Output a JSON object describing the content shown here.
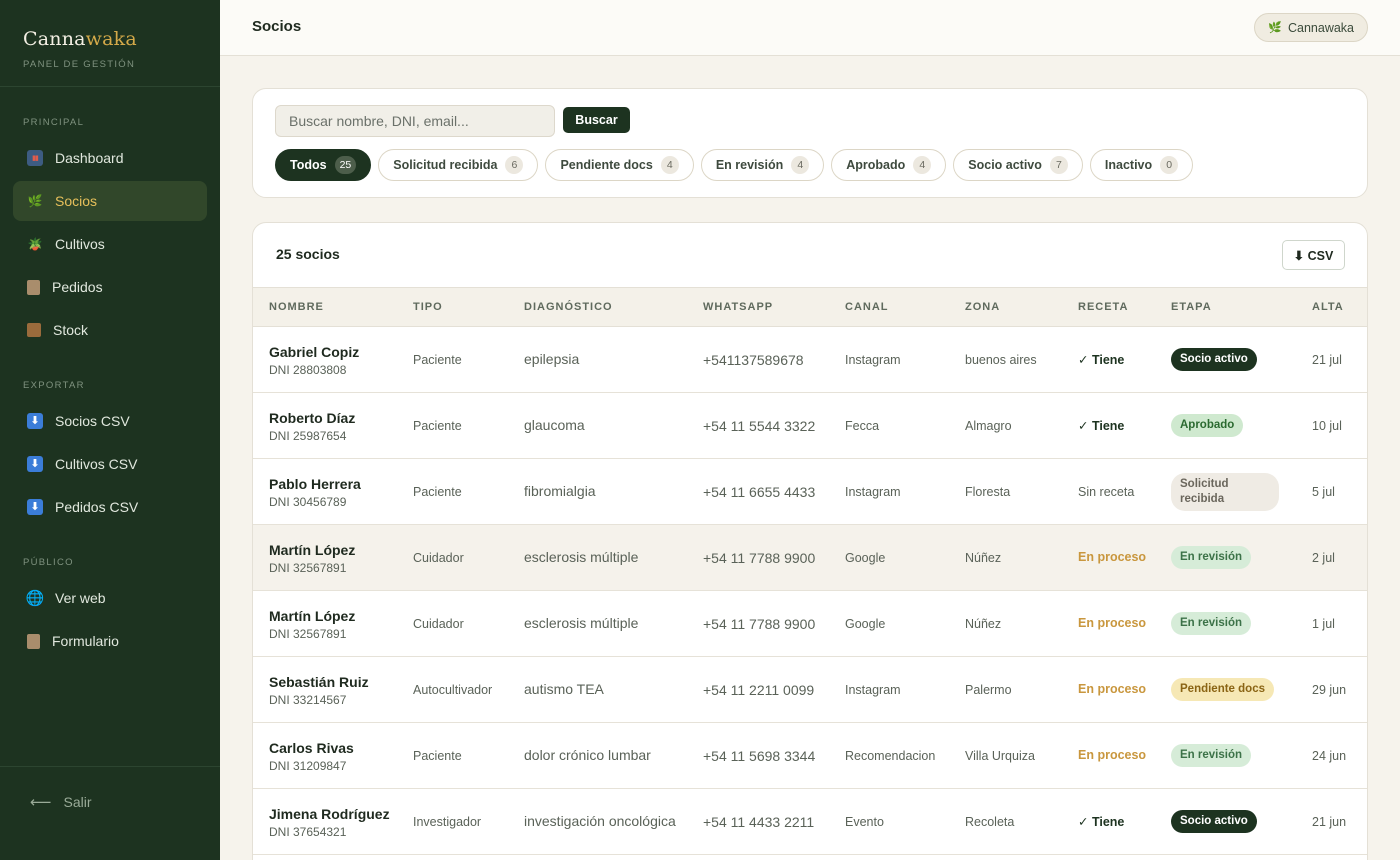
{
  "brand": {
    "name_part1": "Canna",
    "name_part2": "waka",
    "subtitle": "PANEL DE GESTIÓN"
  },
  "sidebar": {
    "sections": [
      {
        "title": "PRINCIPAL",
        "items": [
          {
            "label": "Dashboard",
            "icon": "chart-icon"
          },
          {
            "label": "Socios",
            "icon": "leaf-icon",
            "active": true
          },
          {
            "label": "Cultivos",
            "icon": "plant-pot-icon"
          },
          {
            "label": "Pedidos",
            "icon": "clipboard-icon"
          },
          {
            "label": "Stock",
            "icon": "box-icon"
          }
        ]
      },
      {
        "title": "EXPORTAR",
        "items": [
          {
            "label": "Socios CSV",
            "icon": "download-icon"
          },
          {
            "label": "Cultivos CSV",
            "icon": "download-icon"
          },
          {
            "label": "Pedidos CSV",
            "icon": "download-icon"
          }
        ]
      },
      {
        "title": "PÚBLICO",
        "items": [
          {
            "label": "Ver web",
            "icon": "globe-icon"
          },
          {
            "label": "Formulario",
            "icon": "clipboard-icon"
          }
        ]
      }
    ],
    "logout_label": "Salir"
  },
  "header": {
    "title": "Socios",
    "org_label": "Cannawaka"
  },
  "search": {
    "placeholder": "Buscar nombre, DNI, email...",
    "button_label": "Buscar"
  },
  "filters": [
    {
      "label": "Todos",
      "count": "25",
      "active": true
    },
    {
      "label": "Solicitud recibida",
      "count": "6"
    },
    {
      "label": "Pendiente docs",
      "count": "4"
    },
    {
      "label": "En revisión",
      "count": "4"
    },
    {
      "label": "Aprobado",
      "count": "4"
    },
    {
      "label": "Socio activo",
      "count": "7"
    },
    {
      "label": "Inactivo",
      "count": "0"
    }
  ],
  "table": {
    "count_label": "25 socios",
    "csv_label": "⬇ CSV",
    "columns": [
      "NOMBRE",
      "TIPO",
      "DIAGNÓSTICO",
      "WHATSAPP",
      "CANAL",
      "ZONA",
      "RECETA",
      "ETAPA",
      "ALTA"
    ],
    "rows": [
      {
        "name": "Gabriel Copiz",
        "dni": "DNI 28803808",
        "tipo": "Paciente",
        "diag": "epilepsia",
        "wa": "+541137589678",
        "canal": "Instagram",
        "zona": "buenos aires",
        "receta": "✓ Tiene",
        "receta_kind": "yes",
        "etapa": "Socio activo",
        "etapa_kind": "socio",
        "alta": "21 jul"
      },
      {
        "name": "Roberto Díaz",
        "dni": "DNI 25987654",
        "tipo": "Paciente",
        "diag": "glaucoma",
        "wa": "+54 11 5544 3322",
        "canal": "Fecca",
        "zona": "Almagro",
        "receta": "✓ Tiene",
        "receta_kind": "yes",
        "etapa": "Aprobado",
        "etapa_kind": "aprob",
        "alta": "10 jul"
      },
      {
        "name": "Pablo Herrera",
        "dni": "DNI 30456789",
        "tipo": "Paciente",
        "diag": "fibromialgia",
        "wa": "+54 11 6655 4433",
        "canal": "Instagram",
        "zona": "Floresta",
        "receta": "Sin receta",
        "receta_kind": "none",
        "etapa": "Solicitud recibida",
        "etapa_kind": "solic",
        "alta": "5 jul"
      },
      {
        "name": "Martín López",
        "dni": "DNI 32567891",
        "tipo": "Cuidador",
        "diag": "esclerosis múltiple",
        "wa": "+54 11 7788 9900",
        "canal": "Google",
        "zona": "Núñez",
        "receta": "En proceso",
        "receta_kind": "proc",
        "etapa": "En revisión",
        "etapa_kind": "rev",
        "alta": "2 jul",
        "highlight": true
      },
      {
        "name": "Martín López",
        "dni": "DNI 32567891",
        "tipo": "Cuidador",
        "diag": "esclerosis múltiple",
        "wa": "+54 11 7788 9900",
        "canal": "Google",
        "zona": "Núñez",
        "receta": "En proceso",
        "receta_kind": "proc",
        "etapa": "En revisión",
        "etapa_kind": "rev",
        "alta": "1 jul"
      },
      {
        "name": "Sebastián Ruiz",
        "dni": "DNI 33214567",
        "tipo": "Autocultivador",
        "diag": "autismo TEA",
        "wa": "+54 11 2211 0099",
        "canal": "Instagram",
        "zona": "Palermo",
        "receta": "En proceso",
        "receta_kind": "proc",
        "etapa": "Pendiente docs",
        "etapa_kind": "pend",
        "alta": "29 jun"
      },
      {
        "name": "Carlos Rivas",
        "dni": "DNI 31209847",
        "tipo": "Paciente",
        "diag": "dolor crónico lumbar",
        "wa": "+54 11 5698 3344",
        "canal": "Recomendacion",
        "zona": "Villa Urquiza",
        "receta": "En proceso",
        "receta_kind": "proc",
        "etapa": "En revisión",
        "etapa_kind": "rev",
        "alta": "24 jun"
      },
      {
        "name": "Jimena Rodríguez",
        "dni": "DNI 37654321",
        "tipo": "Investigador",
        "diag": "investigación oncológica",
        "wa": "+54 11 4433 2211",
        "canal": "Evento",
        "zona": "Recoleta",
        "receta": "✓ Tiene",
        "receta_kind": "yes",
        "etapa": "Socio activo",
        "etapa_kind": "socio",
        "alta": "21 jun"
      }
    ]
  },
  "colors": {
    "sidebar_bg": "#1d3320",
    "accent_gold": "#d3a949",
    "active_nav_text": "#e7c05b",
    "page_bg": "#f6f3ec"
  }
}
